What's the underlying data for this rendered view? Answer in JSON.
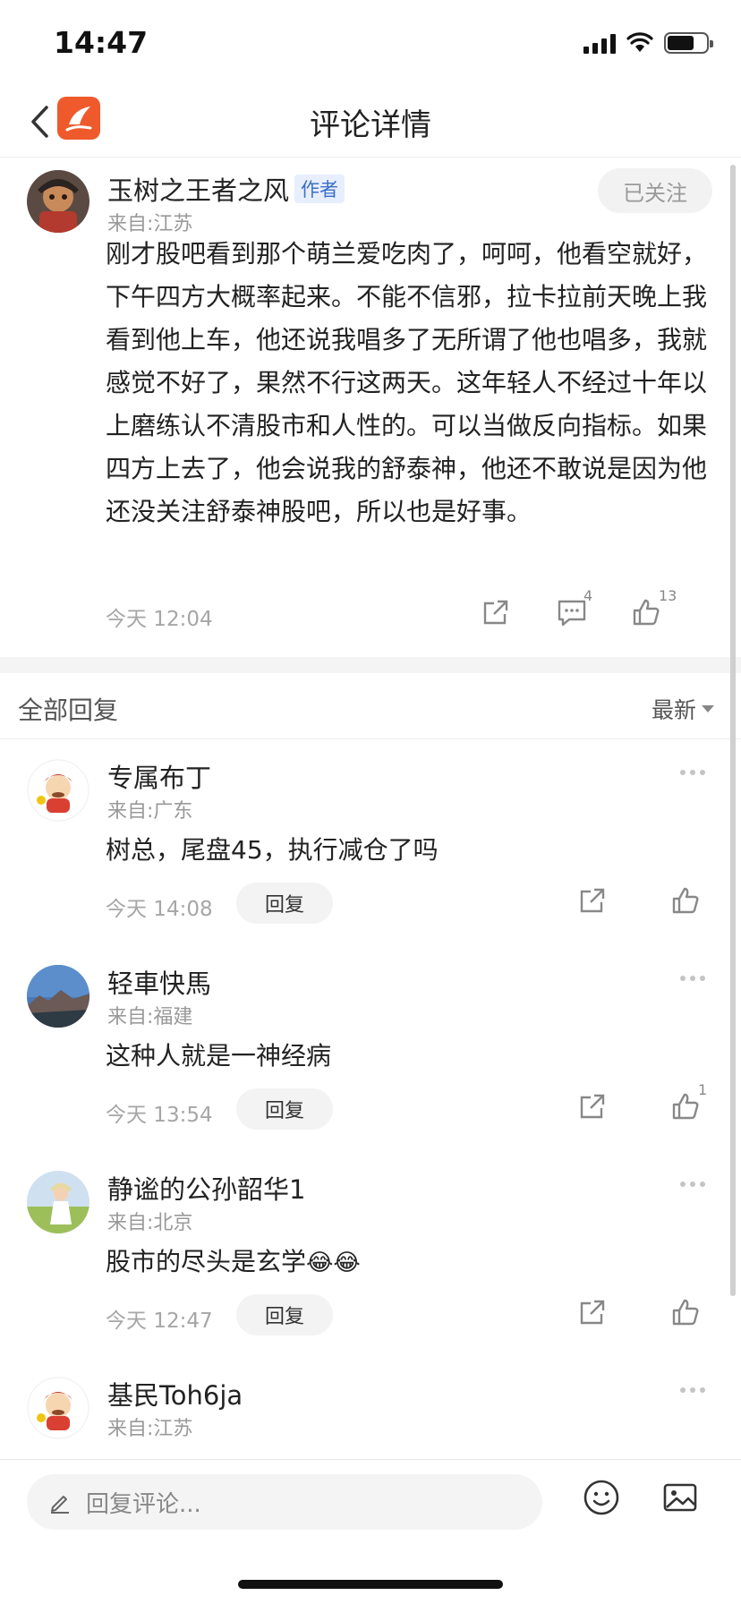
{
  "status_bar": {
    "time": "14:47"
  },
  "nav": {
    "title": "评论详情"
  },
  "post": {
    "author": "玉树之王者之风",
    "author_tag": "作者",
    "location": "来自:江苏",
    "follow_label": "已关注",
    "body": "刚才股吧看到那个萌兰爱吃肉了，呵呵，他看空就好，下午四方大概率起来。不能不信邪，拉卡拉前天晚上我看到他上车，他还说我唱多了无所谓了他也唱多，我就感觉不好了，果然不行这两天。这年轻人不经过十年以上磨练认不清股市和人性的。可以当做反向指标。如果四方上去了，他会说我的舒泰神，他还不敢说是因为他还没关注舒泰神股吧，所以也是好事。",
    "time": "今天 12:04",
    "comment_count": "4",
    "like_count": "13"
  },
  "replies_header": {
    "title": "全部回复",
    "sort_label": "最新"
  },
  "replies": [
    {
      "name": "专属布丁",
      "location": "来自:广东",
      "body": "树总，尾盘45，执行减仓了吗",
      "time": "今天 14:08",
      "reply_label": "回复",
      "like_count": ""
    },
    {
      "name": "轻車快馬",
      "location": "来自:福建",
      "body": "这种人就是一神经病",
      "time": "今天 13:54",
      "reply_label": "回复",
      "like_count": "1"
    },
    {
      "name": "静谧的公孙韶华1",
      "location": "来自:北京",
      "body": "股市的尽头是玄学",
      "emoji": "😂😂",
      "time": "今天 12:47",
      "reply_label": "回复",
      "like_count": ""
    },
    {
      "name": "基民Toh6ja",
      "location": "来自:江苏"
    }
  ],
  "bottom_bar": {
    "input_placeholder": "回复评论..."
  },
  "icons": {
    "back": "chevron-left-icon",
    "logo": "app-logo-icon",
    "share": "share-icon",
    "comment": "comment-icon",
    "like": "thumbs-up-icon",
    "more": "more-icon",
    "edit": "pencil-icon",
    "emoji": "emoji-icon",
    "image": "image-icon"
  },
  "colors": {
    "accent": "#ee5a2c",
    "author_tag": "#3a6fc8",
    "muted": "#a6a6a6"
  }
}
